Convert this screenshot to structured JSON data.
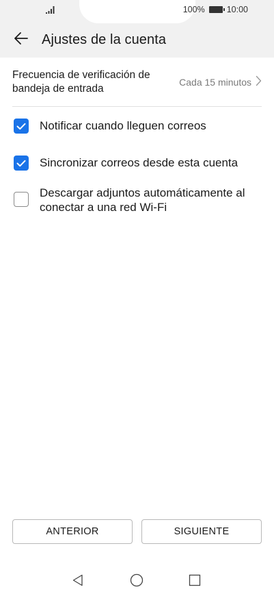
{
  "status_bar": {
    "battery_percent": "100%",
    "time": "10:00",
    "icons": [
      "signal-icon",
      "battery-icon"
    ]
  },
  "app_bar": {
    "title": "Ajustes de la cuenta",
    "back_icon": "arrow-left-icon"
  },
  "settings": {
    "frequency": {
      "label": "Frecuencia de verificación de bandeja de entrada",
      "value": "Cada 15 minutos"
    },
    "options": [
      {
        "label": "Notificar cuando lleguen correos",
        "checked": true
      },
      {
        "label": "Sincronizar correos desde esta cuenta",
        "checked": true
      },
      {
        "label": "Descargar adjuntos automáticamente al conectar a una red Wi-Fi",
        "checked": false
      }
    ]
  },
  "buttons": {
    "previous": "ANTERIOR",
    "next": "SIGUIENTE"
  },
  "nav_bar": {
    "icons": [
      "nav-back-icon",
      "nav-home-icon",
      "nav-recent-icon"
    ]
  },
  "colors": {
    "accent": "#1a73e8",
    "top_bar_bg": "#f1f1f1",
    "secondary_text": "#7a7a7a"
  }
}
